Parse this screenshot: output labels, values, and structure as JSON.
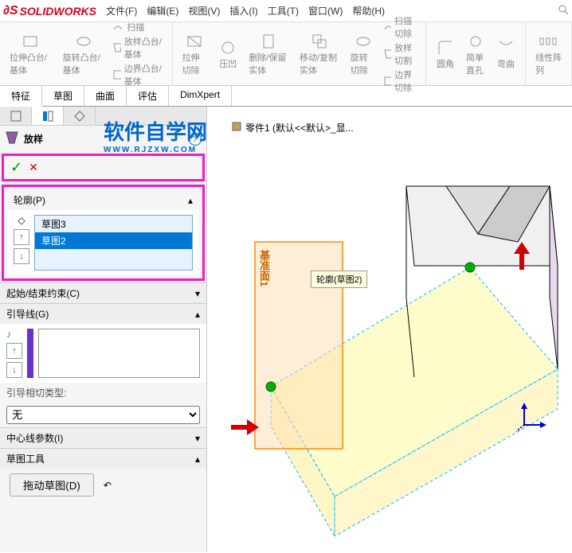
{
  "app": {
    "name": "SOLIDWORKS"
  },
  "menu": {
    "file": "文件(F)",
    "edit": "编辑(E)",
    "view": "视图(V)",
    "insert": "插入(I)",
    "tools": "工具(T)",
    "window": "窗口(W)",
    "help": "帮助(H)"
  },
  "ribbon": {
    "extrude": "拉伸凸台/基体",
    "revolve": "旋转凸台/基体",
    "sweep": "扫描",
    "loft": "放样凸台/基体",
    "boundary": "边界凸台/基体",
    "extrude_cut": "拉伸切除",
    "hole": "压凹",
    "delete_keep": "删除/保留实体",
    "move_copy": "移动/复制实体",
    "revolve_cut": "旋转切除",
    "sweep_cut": "扫描切除",
    "loft_cut": "放样切割",
    "boundary_cut": "边界切除",
    "fillet": "圆角",
    "simple_hole": "简单直孔",
    "wrap": "弯曲",
    "linear_pattern": "线性阵列"
  },
  "tabs": {
    "features": "特征",
    "sketch": "草图",
    "surfaces": "曲面",
    "evaluate": "评估",
    "dimxpert": "DimXpert"
  },
  "watermark": {
    "text": "软件自学网",
    "url": "WWW.RJZXW.COM"
  },
  "document": {
    "title": "零件1  (默认<<默认>_显..."
  },
  "panel": {
    "feature_name": "放样",
    "profiles": {
      "title": "轮廓(P)",
      "items": [
        "草图3",
        "草图2"
      ],
      "selected_index": 1
    },
    "constraints": {
      "title": "起始/结束约束(C)"
    },
    "guides": {
      "title": "引导线(G)"
    },
    "tangent_type": {
      "label": "引导相切类型:",
      "value": "无"
    },
    "centerline": {
      "title": "中心线参数(I)"
    },
    "sketch_tools": {
      "title": "草图工具",
      "drag_button": "拖动草图(D)"
    }
  },
  "viewport": {
    "plane_label": "基准面1",
    "tooltip": "轮廓(草图2)"
  }
}
